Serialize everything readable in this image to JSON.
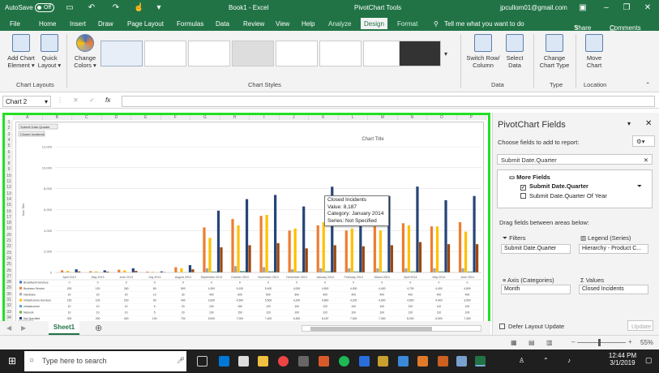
{
  "titlebar": {
    "autosave_label": "AutoSave",
    "autosave_state": "Off",
    "doc_title": "Book1  -  Excel",
    "context_title": "PivotChart Tools",
    "user_email": "jpcullom01@gmail.com"
  },
  "tabs": [
    "File",
    "Home",
    "Insert",
    "Draw",
    "Page Layout",
    "Formulas",
    "Data",
    "Review",
    "View",
    "Help",
    "Analyze",
    "Design",
    "Format"
  ],
  "tell_me": "Tell me what you want to do",
  "share_label": "Share",
  "comments_label": "Comments",
  "ribbon": {
    "add_chart_element": "Add Chart Element",
    "quick_layout": "Quick Layout",
    "change_colors": "Change Colors",
    "switch_row_col": "Switch Row/ Column",
    "select_data": "Select Data",
    "change_chart_type": "Change Chart Type",
    "move_chart": "Move Chart",
    "groups": [
      "Chart Layouts",
      "Chart Styles",
      "Data",
      "Type",
      "Location"
    ]
  },
  "namebox": "Chart 2",
  "sheet": {
    "columns": [
      "A",
      "B",
      "C",
      "D",
      "E",
      "F",
      "G",
      "H",
      "I",
      "J",
      "K",
      "L",
      "M",
      "N",
      "O",
      "P"
    ],
    "rows": [
      "1",
      "2",
      "3",
      "4",
      "5",
      "6",
      "7",
      "8",
      "9",
      "10",
      "11",
      "12",
      "13",
      "14",
      "15",
      "16",
      "17",
      "18",
      "19",
      "20",
      "21",
      "22",
      "23",
      "24",
      "25",
      "26",
      "27",
      "28",
      "29",
      "30",
      "31",
      "32",
      "33",
      "34",
      "35"
    ]
  },
  "chart": {
    "filter_button": "Submit Date.Quarter",
    "value_button": "Closed Incidents",
    "axis_button": "Month"
  },
  "chart_data": {
    "type": "bar",
    "title": "Chart Title",
    "xlabel": "",
    "ylabel": "Axis Title",
    "ylim": [
      0,
      12000
    ],
    "yticks": [
      "0",
      "2,000",
      "4,000",
      "6,000",
      "8,000",
      "10,000",
      "12,000"
    ],
    "categories": [
      "April 2013",
      "May 2013",
      "June 2013",
      "July 2013",
      "August 2013",
      "September 2013",
      "October 2013",
      "November 2013",
      "December 2013",
      "January 2014",
      "February 2014",
      "March 2014",
      "April 2014",
      "May 2014",
      "June 2014"
    ],
    "series": [
      {
        "name": "Broadband Services",
        "color": "#4472c4",
        "values": [
          0,
          0,
          0,
          0,
          0,
          0,
          0,
          0,
          0,
          0,
          0,
          0,
          0,
          0,
          0
        ]
      },
      {
        "name": "Business Service",
        "color": "#ed7d31",
        "values": [
          200,
          120,
          260,
          80,
          500,
          4300,
          5100,
          5400,
          4000,
          4500,
          4000,
          4400,
          4700,
          4400,
          4800
        ]
      },
      {
        "name": "Hardware",
        "color": "#a5a5a5",
        "values": [
          20,
          20,
          20,
          10,
          30,
          400,
          600,
          500,
          300,
          400,
          400,
          400,
          400,
          400,
          400
        ]
      },
      {
        "name": "Infrastructure Services",
        "color": "#ffc000",
        "values": [
          150,
          100,
          200,
          60,
          400,
          3300,
          4500,
          5500,
          4200,
          4800,
          4200,
          4000,
          4500,
          4400,
          3900
        ]
      },
      {
        "name": "Infrastructure",
        "color": "#5b9bd5",
        "values": [
          10,
          10,
          10,
          5,
          20,
          100,
          150,
          120,
          100,
          120,
          100,
          100,
          120,
          110,
          100
        ]
      },
      {
        "name": "Network",
        "color": "#70ad47",
        "values": [
          10,
          10,
          10,
          5,
          20,
          100,
          150,
          120,
          100,
          120,
          100,
          100,
          120,
          110,
          100
        ]
      },
      {
        "name": "Not Specified",
        "color": "#264478",
        "values": [
          300,
          200,
          400,
          100,
          700,
          5900,
          7000,
          7400,
          6300,
          8187,
          7000,
          7300,
          8200,
          6900,
          7300
        ]
      },
      {
        "name": "Software",
        "color": "#9e480e",
        "values": [
          100,
          80,
          150,
          40,
          300,
          2400,
          2600,
          2800,
          2300,
          2600,
          2500,
          2600,
          2900,
          2700,
          2700
        ]
      }
    ]
  },
  "table_rows": [
    {
      "label": "Broadband Services"
    },
    {
      "label": "Business Service"
    },
    {
      "label": "Hardware"
    },
    {
      "label": "Infrastructure Services"
    },
    {
      "label": "Infrastructure"
    },
    {
      "label": "Network"
    },
    {
      "label": "Not Specified"
    },
    {
      "label": "Software"
    }
  ],
  "tooltip": {
    "line1": "Closed Incidents",
    "line2": "Value: 8,187",
    "line3": "Category: January 2014",
    "line4": "Series: Not Specified"
  },
  "pane": {
    "title": "PivotChart Fields",
    "choose_label": "Choose fields to add to report:",
    "search_value": "Submit Date.Quarter",
    "more_fields": "More Fields",
    "field1": "Submit Date.Quarter",
    "field2": "Submit Date.Quarter Of Year",
    "drag_label": "Drag fields between areas below:",
    "filters_label": "Filters",
    "legend_label": "Legend (Series)",
    "axis_label": "Axis (Categories)",
    "values_label": "Values",
    "filters_value": "Submit Date.Quarter",
    "legend_value": "Hierarchy - Product C...",
    "axis_value": "Month",
    "values_value": "Closed Incidents",
    "defer_label": "Defer Layout Update",
    "update_label": "Update"
  },
  "sheet_tab": "Sheet1",
  "zoom": "55%",
  "taskbar": {
    "search_placeholder": "Type here to search",
    "time": "12:44 PM",
    "date": "3/1/2019"
  }
}
